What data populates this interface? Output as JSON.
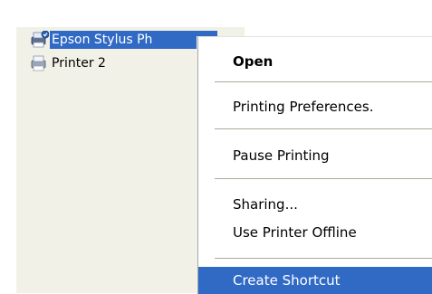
{
  "printers": [
    {
      "name": "Epson Stylus Ph",
      "selected": true
    },
    {
      "name": "Printer 2",
      "selected": false
    }
  ],
  "details_column": {
    "text_1": "",
    "text_2": ""
  },
  "context_menu": {
    "items": [
      {
        "label": "Open",
        "bold": true
      },
      {
        "label": "Printing Preferences."
      },
      {
        "label": "Pause Printing"
      },
      {
        "label": "Sharing..."
      },
      {
        "label": "Use Printer Offline"
      },
      {
        "label": "Create Shortcut",
        "highlighted": true
      }
    ]
  },
  "colors": {
    "selection": "#316ac5",
    "pane_background": "#f2f1e8",
    "separator": "#aca899"
  },
  "icons": {
    "printer_default": "default-printer-icon",
    "printer": "printer-icon"
  }
}
